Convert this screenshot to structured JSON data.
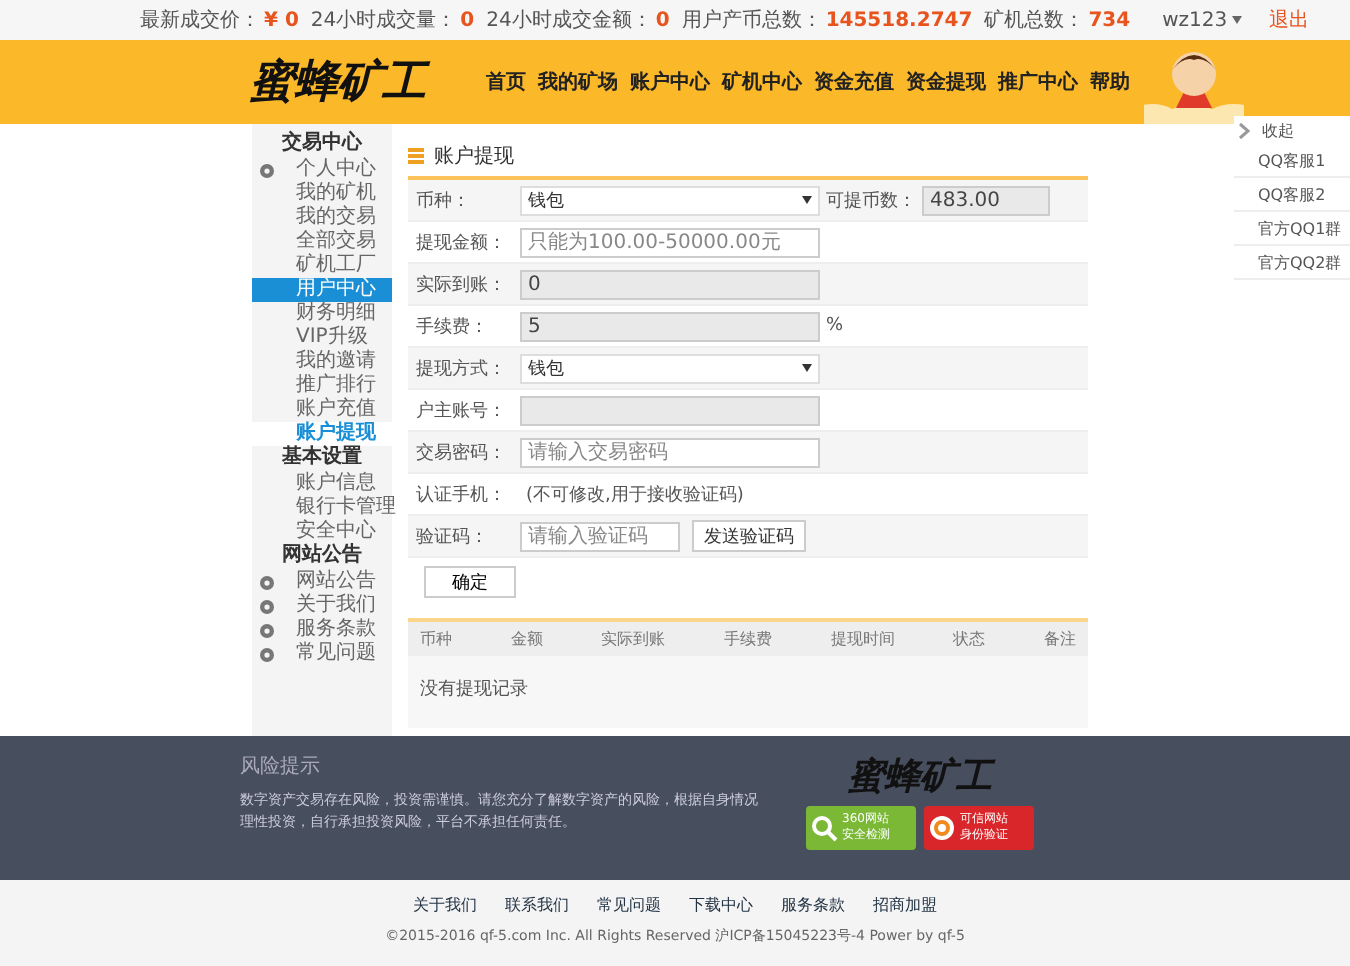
{
  "top_bar": {
    "stats": [
      {
        "label": "最新成交价：",
        "value": "¥ 0"
      },
      {
        "label": "24小时成交量：",
        "value": "0"
      },
      {
        "label": "24小时成交金额：",
        "value": "0"
      },
      {
        "label": "用户产币总数：",
        "value": "145518.2747"
      },
      {
        "label": "矿机总数：",
        "value": "734"
      }
    ],
    "user": "wz123",
    "logout": "退出"
  },
  "header": {
    "logo": "蜜蜂矿工",
    "nav": [
      "首页",
      "我的矿场",
      "账户中心",
      "矿机中心",
      "资金充值",
      "资金提现",
      "推广中心",
      "帮助"
    ]
  },
  "sidebar": [
    {
      "title": "交易中心",
      "items": [
        {
          "label": "个人中心",
          "kind": "icon",
          "selected": false,
          "hovered": false
        },
        {
          "label": "我的矿机",
          "kind": "plain",
          "selected": false,
          "hovered": false
        },
        {
          "label": "我的交易",
          "kind": "plain",
          "selected": false,
          "hovered": false
        },
        {
          "label": "全部交易",
          "kind": "plain",
          "selected": false,
          "hovered": false
        },
        {
          "label": "矿机工厂",
          "kind": "plain",
          "selected": false,
          "hovered": false
        },
        {
          "label": "用户中心",
          "kind": "plain",
          "selected": false,
          "hovered": true
        },
        {
          "label": "财务明细",
          "kind": "plain",
          "selected": false,
          "hovered": false
        },
        {
          "label": "VIP升级",
          "kind": "plain",
          "selected": false,
          "hovered": false
        },
        {
          "label": "我的邀请",
          "kind": "plain",
          "selected": false,
          "hovered": false
        },
        {
          "label": "推广排行",
          "kind": "plain",
          "selected": false,
          "hovered": false
        },
        {
          "label": "账户充值",
          "kind": "plain",
          "selected": false,
          "hovered": false
        },
        {
          "label": "账户提现",
          "kind": "plain",
          "selected": true,
          "hovered": false
        }
      ]
    },
    {
      "title": "基本设置",
      "items": [
        {
          "label": "账户信息",
          "kind": "plain",
          "selected": false,
          "hovered": false
        },
        {
          "label": "银行卡管理",
          "kind": "plain",
          "selected": false,
          "hovered": false
        },
        {
          "label": "安全中心",
          "kind": "plain",
          "selected": false,
          "hovered": false
        }
      ]
    },
    {
      "title": "网站公告",
      "items": [
        {
          "label": "网站公告",
          "kind": "icon",
          "selected": false,
          "hovered": false
        },
        {
          "label": "关于我们",
          "kind": "icon",
          "selected": false,
          "hovered": false
        },
        {
          "label": "服务条款",
          "kind": "icon",
          "selected": false,
          "hovered": false
        },
        {
          "label": "常见问题",
          "kind": "icon",
          "selected": false,
          "hovered": false
        }
      ]
    }
  ],
  "panel_title": "账户提现",
  "form": [
    {
      "label": "币种：",
      "kind": "select",
      "value": "钱包",
      "extra_label": "可提币数：",
      "extra_value": "483.00"
    },
    {
      "label": "提现金额：",
      "kind": "input",
      "placeholder": "只能为100.00-50000.00元"
    },
    {
      "label": "实际到账：",
      "kind": "readonly",
      "value": "0"
    },
    {
      "label": "手续费：",
      "kind": "readonly",
      "value": "5",
      "suffix": "%"
    },
    {
      "label": "提现方式：",
      "kind": "select",
      "value": "钱包"
    },
    {
      "label": "户主账号：",
      "kind": "readonly"
    },
    {
      "label": "交易密码：",
      "kind": "input",
      "placeholder": "请输入交易密码"
    },
    {
      "label": "认证手机：",
      "kind": "text",
      "value": "(不可修改,用于接收验证码)"
    },
    {
      "label": "验证码：",
      "kind": "captcha",
      "placeholder": "请输入验证码",
      "button": "发送验证码"
    }
  ],
  "submit": "确定",
  "table": {
    "columns": [
      "币种",
      "金额",
      "实际到账",
      "手续费",
      "提现时间",
      "状态",
      "备注"
    ],
    "empty": "没有提现记录"
  },
  "footer": {
    "risk_title": "风险提示",
    "risk_text": "数字资产交易存在风险，投资需谨慎。请您充分了解数字资产的风险，根据自身情况理性投资，自行承担投资风险，平台不承担任何责任。",
    "logo": "蜜蜂矿工",
    "badges": [
      {
        "kind": "scan",
        "line1": "360网站",
        "line2": "安全检测"
      },
      {
        "kind": "trust",
        "line1": "可信网站",
        "line2": "身份验证"
      }
    ],
    "links": [
      "关于我们",
      "联系我们",
      "常见问题",
      "下载中心",
      "服务条款",
      "招商加盟"
    ],
    "copyright": "©2015-2016 qf-5.com Inc. All Rights Reserved 沪ICP备15045223号-4 Power by qf-5"
  },
  "float_panel": {
    "collapse": "收起",
    "items": [
      "QQ客服1",
      "QQ客服2",
      "官方QQ1群",
      "官方QQ2群"
    ]
  }
}
